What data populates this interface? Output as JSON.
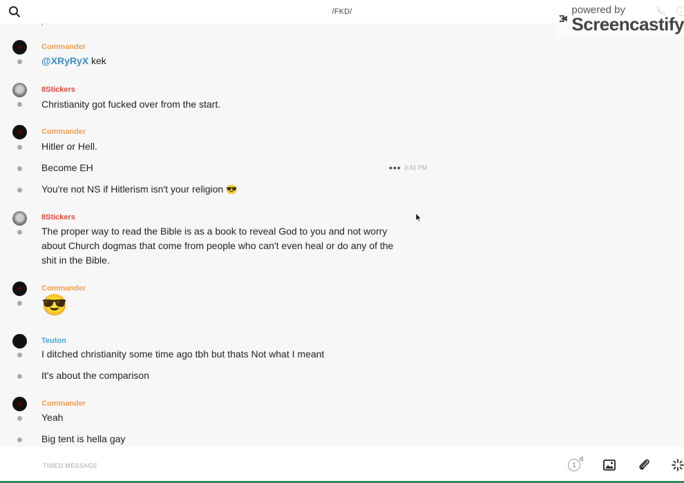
{
  "header": {
    "channel": "/FKD/",
    "watermark": {
      "line1": "powered by",
      "line2": "Screencastify"
    }
  },
  "feed": {
    "cut_top_text": "/",
    "messages": [
      {
        "author": "Commander",
        "author_color": "#f0a050",
        "lines": [
          {
            "mention": "@XRyRyX",
            "text": " kek"
          }
        ]
      },
      {
        "author": "8Stickers",
        "author_color": "#e04a3c",
        "lines": [
          {
            "text": "Christianity got fucked over from the start."
          }
        ]
      },
      {
        "author": "Commander",
        "author_color": "#f0a050",
        "lines": [
          {
            "text": "Hitler or Hell."
          },
          {
            "text": "Become EH",
            "time": "3:41 PM",
            "more": "•••"
          },
          {
            "text": "You're not NS if Hitlerism isn't your religion",
            "emoji": "😎"
          }
        ]
      },
      {
        "author": "8Stickers",
        "author_color": "#e04a3c",
        "lines": [
          {
            "text": "The proper way to read the Bible is as a book to reveal God to you and not worry about Church dogmas that come from people who can't even heal or do any of the shit in the Bible."
          }
        ]
      },
      {
        "author": "Commander",
        "author_color": "#f0a050",
        "lines": [
          {
            "emoji": "😎"
          }
        ]
      },
      {
        "author": "Teuton",
        "author_color": "#44a6d6",
        "lines": [
          {
            "text": "I ditched christianity some time ago tbh but thats Not what I meant"
          },
          {
            "text": "It's about the comparison"
          }
        ]
      },
      {
        "author": "Commander",
        "author_color": "#f0a050",
        "lines": [
          {
            "text": "Yeah"
          },
          {
            "text": "Big tent is hella gay"
          }
        ]
      }
    ]
  },
  "composer": {
    "placeholder": "TIMED MESSAGE",
    "timer_value": "1",
    "timer_unit": "d"
  },
  "icons": [
    "search-icon",
    "phone-icon",
    "info-icon",
    "screencastify-logo-icon",
    "ellipsis-icon",
    "cursor-icon",
    "timer-icon",
    "image-icon",
    "paperclip-icon",
    "sparkle-icon"
  ]
}
